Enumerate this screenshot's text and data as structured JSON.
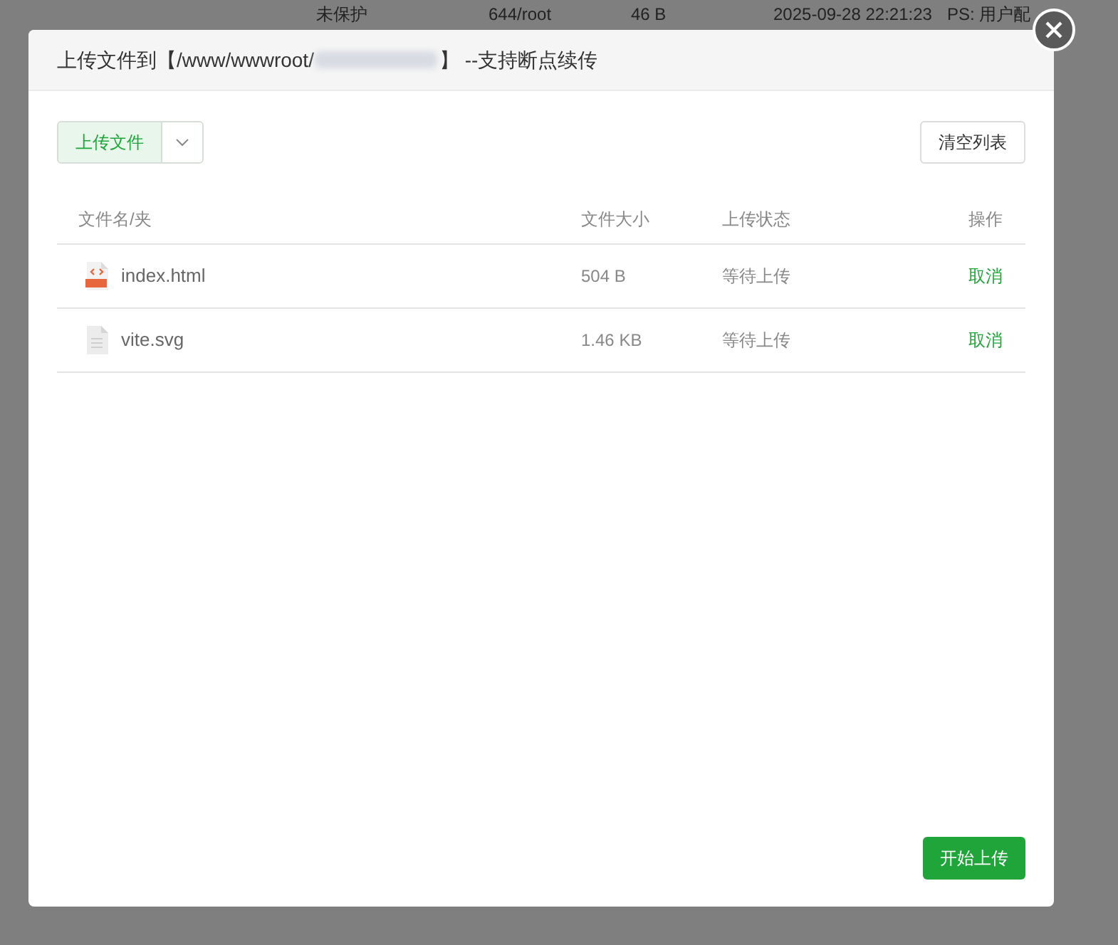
{
  "background_row": {
    "cells": [
      "未保护",
      "644/root",
      "46 B",
      "2025-09-28 22:21:23",
      "PS: 用户配"
    ]
  },
  "dialog": {
    "title_prefix": "上传文件到【/www/wwwroot/",
    "title_suffix": "】 --支持断点续传",
    "path_redacted": true
  },
  "toolbar": {
    "upload_button": "上传文件",
    "clear_button": "清空列表"
  },
  "table": {
    "columns": [
      "文件名/夹",
      "文件大小",
      "上传状态",
      "操作"
    ],
    "rows": [
      {
        "kind": "html",
        "name": "index.html",
        "size": "504 B",
        "status": "等待上传",
        "action": "取消"
      },
      {
        "kind": "text",
        "name": "vite.svg",
        "size": "1.46 KB",
        "status": "等待上传",
        "action": "取消"
      }
    ]
  },
  "start_button": "开始上传"
}
